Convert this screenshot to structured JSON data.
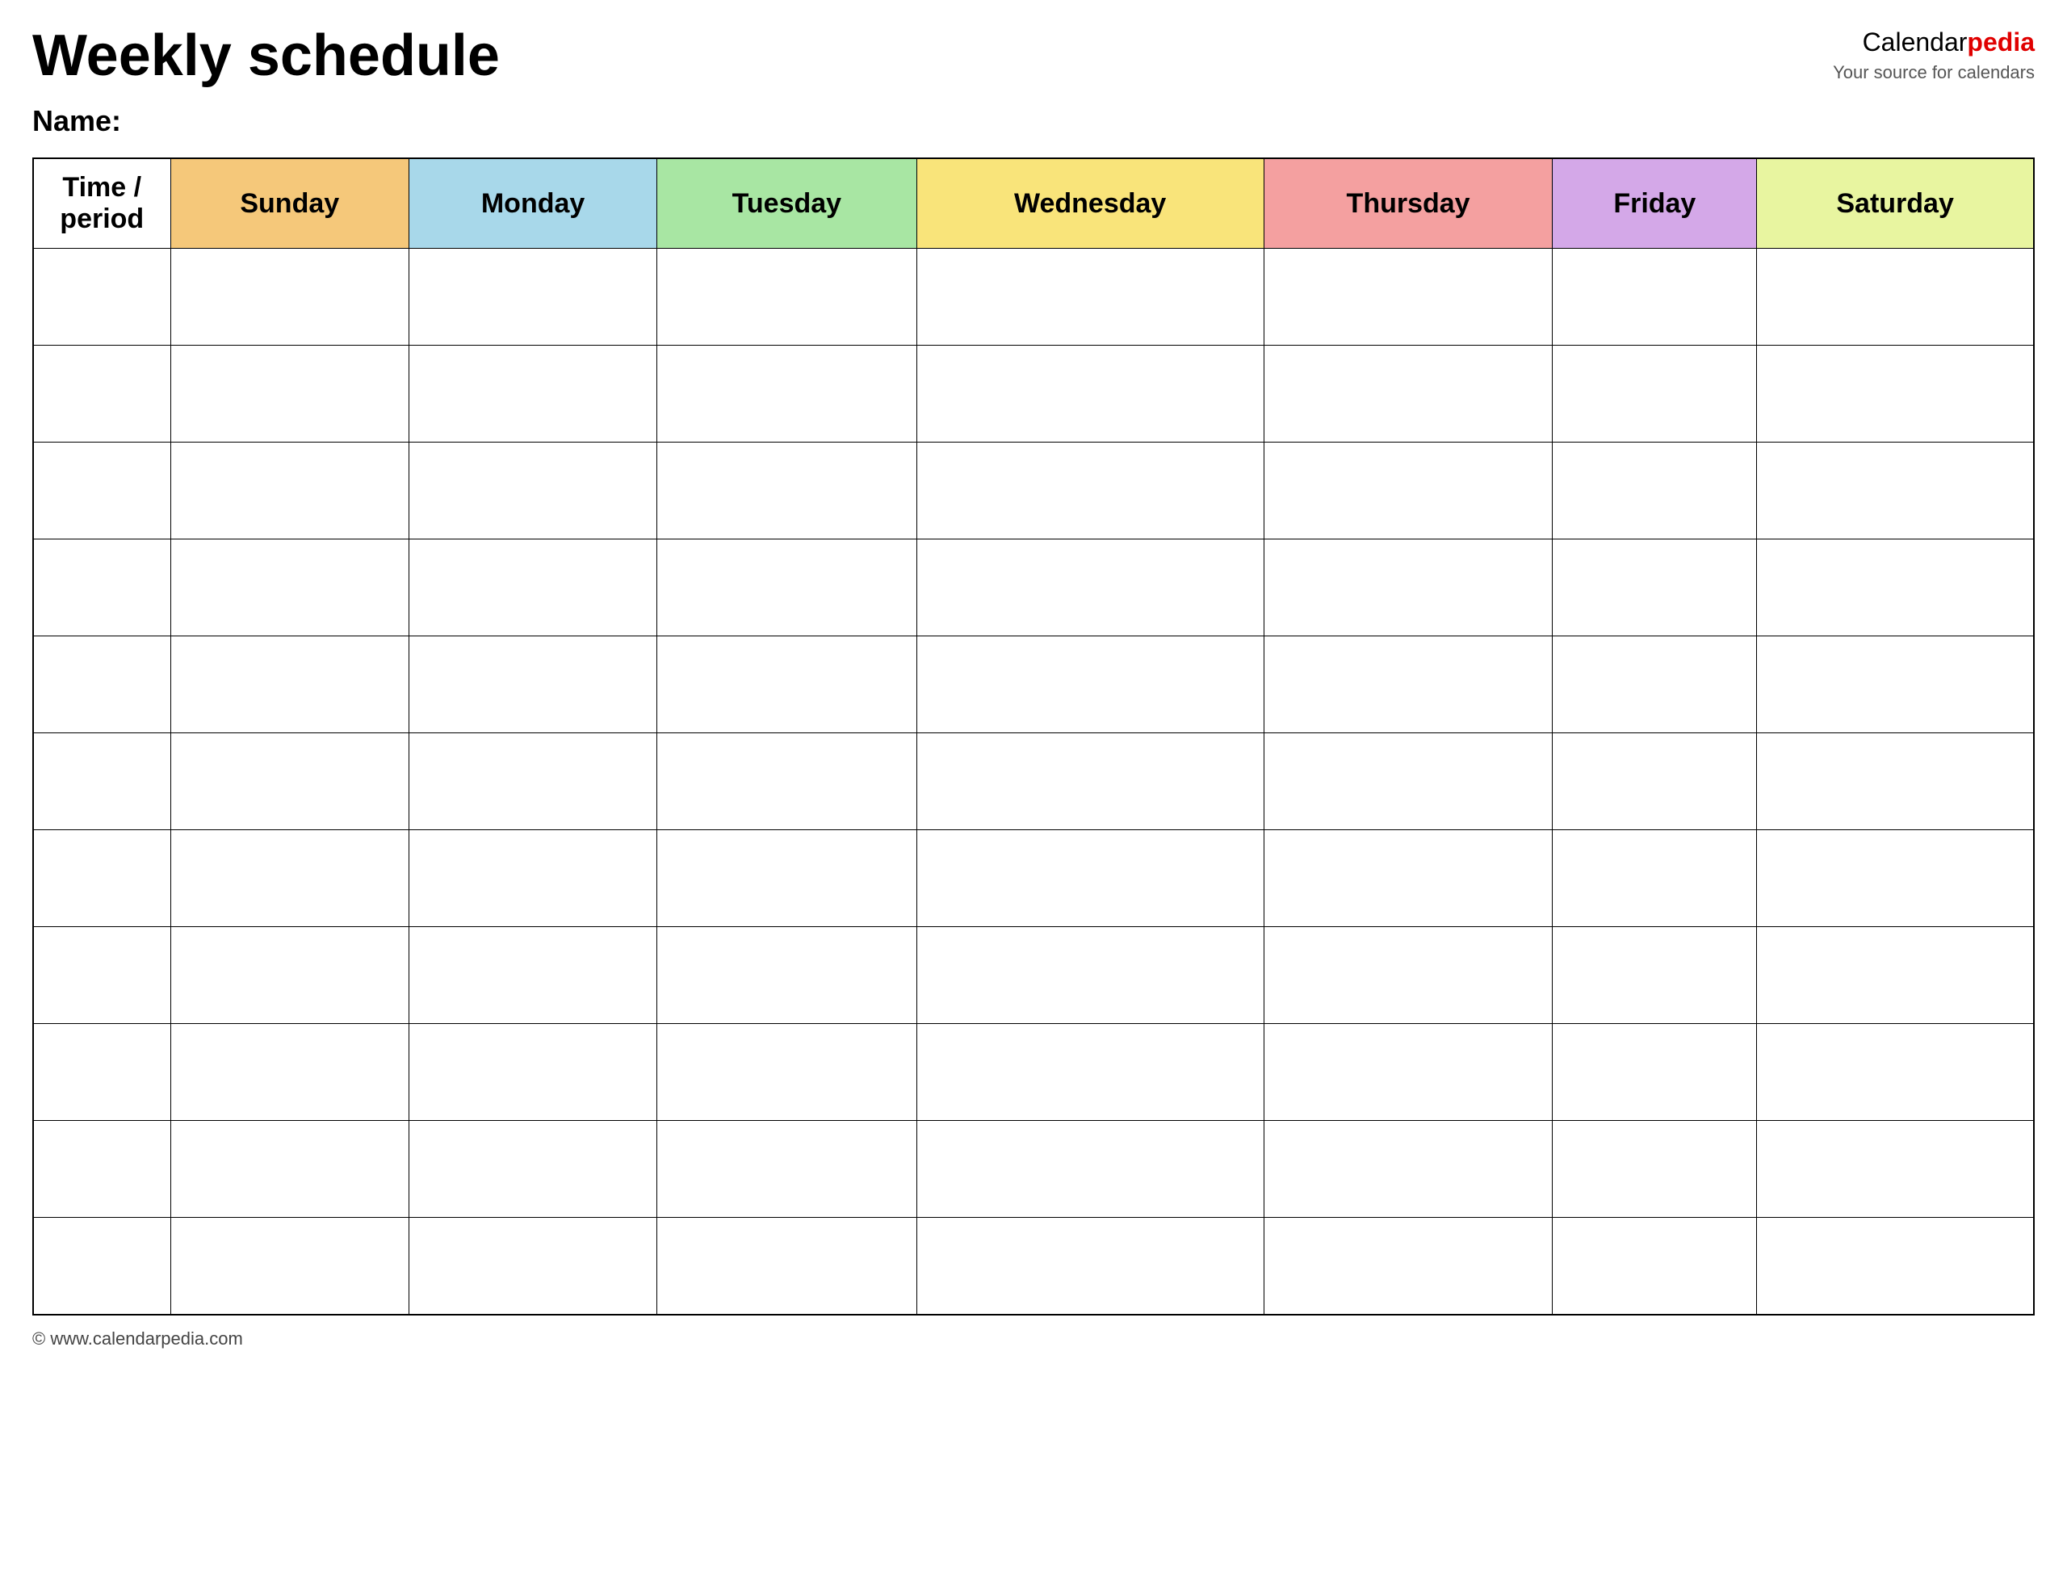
{
  "header": {
    "title": "Weekly schedule",
    "name_label": "Name:",
    "brand": {
      "calendar": "Calendar",
      "pedia": "pedia",
      "tagline": "Your source for calendars"
    }
  },
  "table": {
    "columns": [
      {
        "key": "time",
        "label": "Time / period",
        "color": "#ffffff"
      },
      {
        "key": "sunday",
        "label": "Sunday",
        "color": "#f5c87a"
      },
      {
        "key": "monday",
        "label": "Monday",
        "color": "#a8d8ea"
      },
      {
        "key": "tuesday",
        "label": "Tuesday",
        "color": "#a8e6a3"
      },
      {
        "key": "wednesday",
        "label": "Wednesday",
        "color": "#f9e47a"
      },
      {
        "key": "thursday",
        "label": "Thursday",
        "color": "#f4a0a0"
      },
      {
        "key": "friday",
        "label": "Friday",
        "color": "#d4a8e8"
      },
      {
        "key": "saturday",
        "label": "Saturday",
        "color": "#e8f5a0"
      }
    ],
    "row_count": 11
  },
  "footer": {
    "url": "© www.calendarpedia.com"
  }
}
